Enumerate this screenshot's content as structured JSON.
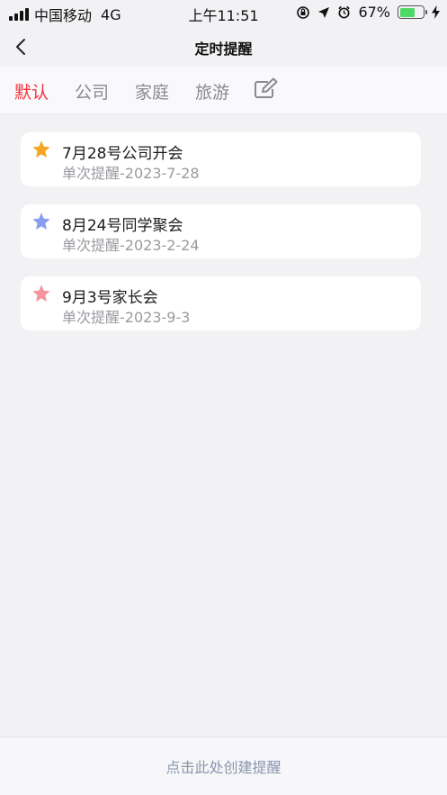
{
  "status_bar": {
    "carrier": "中国移动",
    "network": "4G",
    "time": "上午11:51",
    "battery_percent": "67%",
    "battery_level": 0.67,
    "battery_color": "#4cd964",
    "icons": [
      "signal-icon",
      "lock-rotation-icon",
      "location-icon",
      "alarm-icon",
      "battery-icon",
      "charging-icon"
    ]
  },
  "nav": {
    "back_icon": "chevron-left-icon",
    "title": "定时提醒"
  },
  "tabs": [
    {
      "label": "默认",
      "active": true
    },
    {
      "label": "公司",
      "active": false
    },
    {
      "label": "家庭",
      "active": false
    },
    {
      "label": "旅游",
      "active": false
    }
  ],
  "tab_edit_icon": "edit-icon",
  "accent_color": "#f2323a",
  "reminders": [
    {
      "title": "7月28号公司开会",
      "subtitle": "单次提醒-2023-7-28",
      "star_color": "#f5a623",
      "icon": "star-icon"
    },
    {
      "title": "8月24号同学聚会",
      "subtitle": "单次提醒-2023-2-24",
      "star_color": "#8a9cf0",
      "icon": "star-icon"
    },
    {
      "title": "9月3号家长会",
      "subtitle": "单次提醒-2023-9-3",
      "star_color": "#f2959c",
      "icon": "star-icon"
    }
  ],
  "bottom": {
    "create_label": "点击此处创建提醒"
  }
}
